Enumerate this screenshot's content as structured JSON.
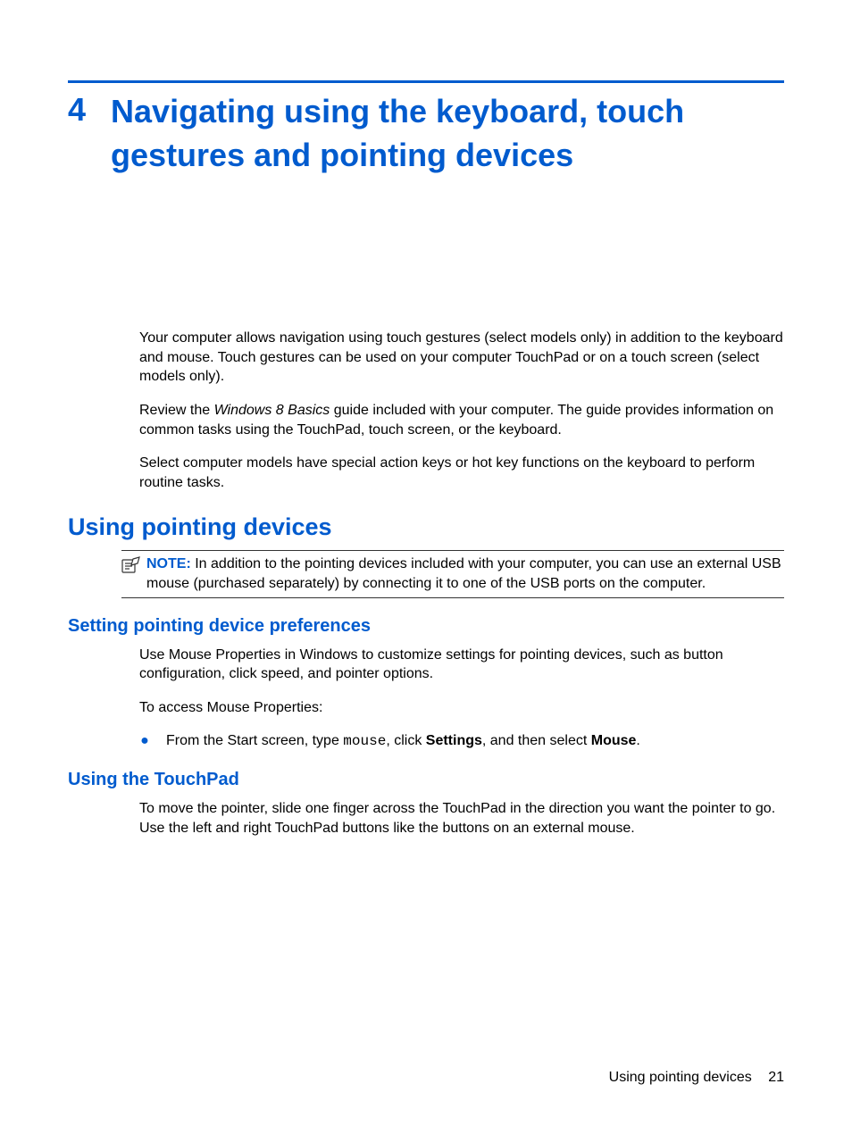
{
  "chapter": {
    "number": "4",
    "title": "Navigating using the keyboard, touch gestures and pointing devices"
  },
  "intro": {
    "p1_before": "Your computer allows navigation using touch gestures (select models only) in addition to the keyboard and mouse. Touch gestures can be used on your computer TouchPad or on a touch screen (select models only).",
    "p2_prefix": "Review the ",
    "p2_em": "Windows 8 Basics",
    "p2_suffix": " guide included with your computer. The guide provides information on common tasks using the TouchPad, touch screen, or the keyboard.",
    "p3": "Select computer models have special action keys or hot key functions on the keyboard to perform routine tasks."
  },
  "section1": {
    "heading": "Using pointing devices",
    "note_label": "NOTE:",
    "note_body": "In addition to the pointing devices included with your computer, you can use an external USB mouse (purchased separately) by connecting it to one of the USB ports on the computer."
  },
  "subsection1": {
    "heading": "Setting pointing device preferences",
    "p1": "Use Mouse Properties in Windows to customize settings for pointing devices, such as button configuration, click speed, and pointer options.",
    "p2": "To access Mouse Properties:",
    "bullet_prefix": "From the Start screen, type ",
    "bullet_mono": "mouse",
    "bullet_mid1": ", click ",
    "bullet_b1": "Settings",
    "bullet_mid2": ", and then select ",
    "bullet_b2": "Mouse",
    "bullet_suffix": "."
  },
  "subsection2": {
    "heading": "Using the TouchPad",
    "p1": "To move the pointer, slide one finger across the TouchPad in the direction you want the pointer to go. Use the left and right TouchPad buttons like the buttons on an external mouse."
  },
  "footer": {
    "text": "Using pointing devices",
    "page": "21"
  }
}
